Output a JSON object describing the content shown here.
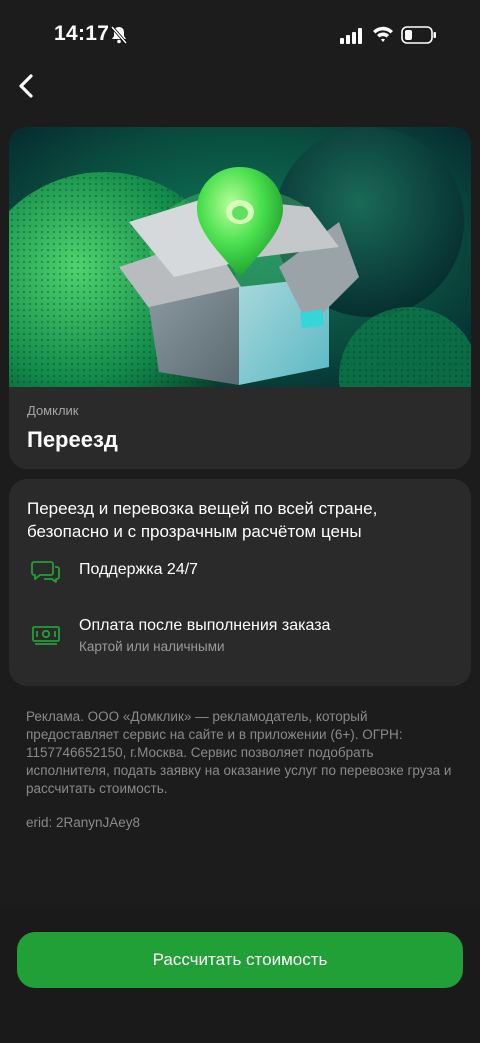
{
  "status_bar": {
    "time": "14:17"
  },
  "hero": {
    "brand": "Домклик",
    "title": "Переезд"
  },
  "info": {
    "description": "Переезд и перевозка вещей по всей стране, безопасно и с прозрачным расчётом цены",
    "features": [
      {
        "title": "Поддержка 24/7",
        "subtitle": ""
      },
      {
        "title": "Оплата после выполнения заказа",
        "subtitle": "Картой или наличными"
      }
    ]
  },
  "legal": {
    "text": "Реклама. ООО «Домклик» — рекламодатель, который предоставляет сервис на сайте и в приложении (6+). ОГРН: 1157746652150, г.Москва. Сервис позволяет подобрать исполнителя, подать заявку на оказание услуг по перевозке груза и рассчитать стоимость.",
    "erid": "erid: 2RanynJAey8"
  },
  "cta": {
    "label": "Рассчитать стоимость"
  },
  "colors": {
    "accent": "#21a038",
    "background": "#1c1c1c",
    "card": "#2a2a2a"
  }
}
